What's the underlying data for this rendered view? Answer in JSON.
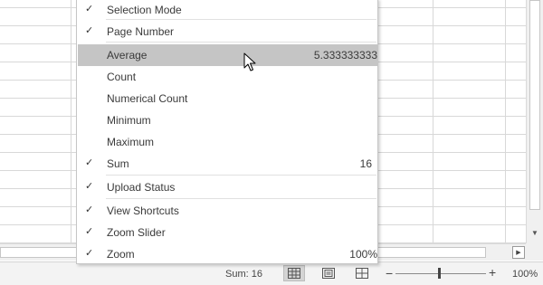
{
  "menu": {
    "items": [
      {
        "checked": true,
        "label": "Selection Mode",
        "value": ""
      },
      {
        "checked": true,
        "label": "Page Number",
        "value": ""
      },
      {
        "checked": false,
        "label": "Average",
        "value": "5.333333333"
      },
      {
        "checked": false,
        "label": "Count",
        "value": ""
      },
      {
        "checked": false,
        "label": "Numerical Count",
        "value": ""
      },
      {
        "checked": false,
        "label": "Minimum",
        "value": ""
      },
      {
        "checked": false,
        "label": "Maximum",
        "value": ""
      },
      {
        "checked": true,
        "label": "Sum",
        "value": "16"
      },
      {
        "checked": true,
        "label": "Upload Status",
        "value": ""
      },
      {
        "checked": true,
        "label": "View Shortcuts",
        "value": ""
      },
      {
        "checked": true,
        "label": "Zoom Slider",
        "value": ""
      },
      {
        "checked": true,
        "label": "Zoom",
        "value": "100%"
      }
    ],
    "check_glyph": "✓",
    "highlighted_item": "Average"
  },
  "status_bar": {
    "sum": "Sum: 16",
    "zoom_minus": "−",
    "zoom_plus": "+",
    "zoom_level": "100%",
    "active_view": "normal-view"
  },
  "colors": {
    "highlight": "#c5c5c5",
    "status_bg": "#f3f3f3",
    "gridline": "#d8d8d8"
  }
}
